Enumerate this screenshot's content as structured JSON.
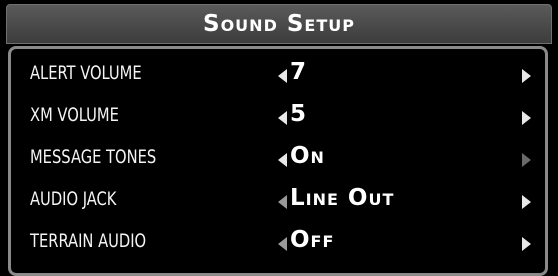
{
  "title": "Sound Setup",
  "colors": {
    "background": "#000000",
    "title_bar": "#4a4a4a",
    "panel_border": "#8a8a8a",
    "text": "#ffffff"
  },
  "settings": [
    {
      "label": "ALERT VOLUME",
      "value": "7",
      "left_arrow_icon": "arrow-left-icon",
      "right_arrow_icon": "arrow-right-icon"
    },
    {
      "label": "XM VOLUME",
      "value": "5",
      "left_arrow_icon": "arrow-left-icon",
      "right_arrow_icon": "arrow-right-icon"
    },
    {
      "label": "MESSAGE TONES",
      "value": "On",
      "left_arrow_icon": "arrow-left-icon",
      "right_arrow_icon": "arrow-right-icon"
    },
    {
      "label": "AUDIO JACK",
      "value": "Line Out",
      "left_arrow_icon": "arrow-left-icon",
      "right_arrow_icon": "arrow-right-icon"
    },
    {
      "label": "TERRAIN AUDIO",
      "value": "Off",
      "left_arrow_icon": "arrow-left-icon",
      "right_arrow_icon": "arrow-right-icon"
    }
  ]
}
